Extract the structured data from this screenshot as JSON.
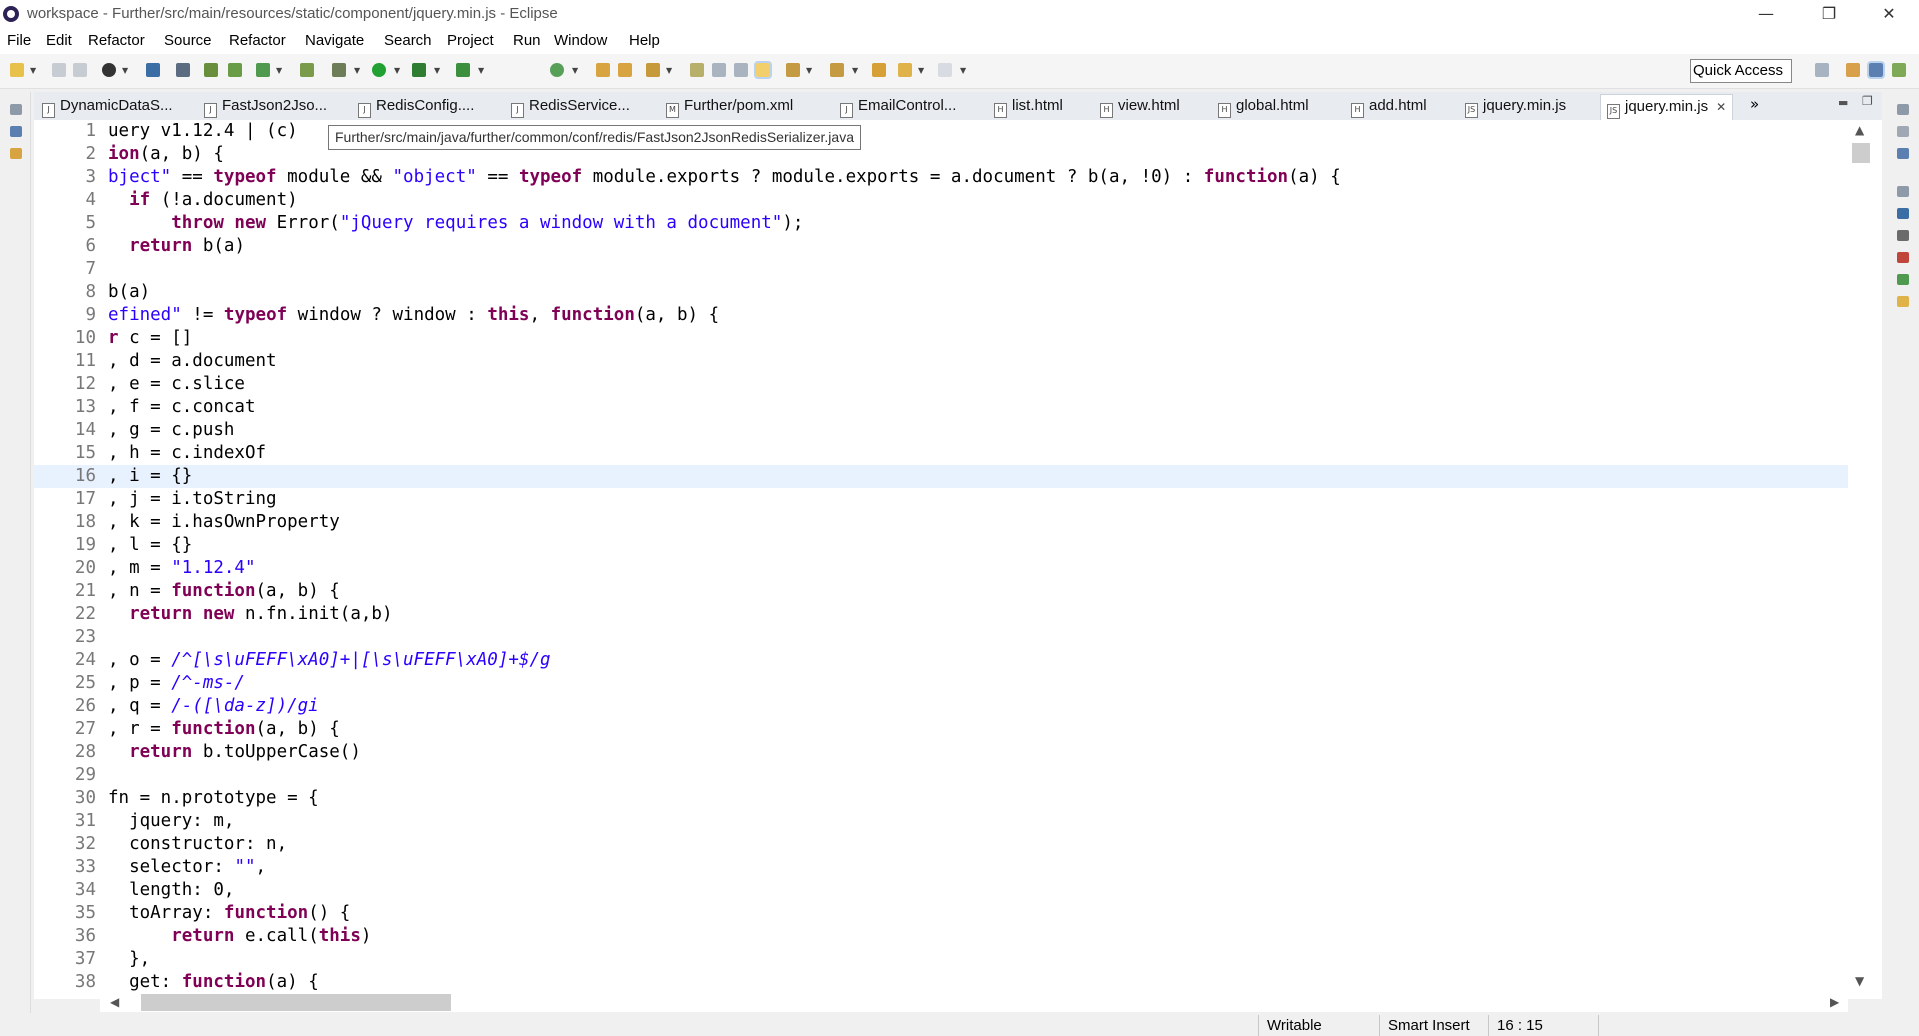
{
  "window": {
    "title": "workspace - Further/src/main/resources/static/component/jquery.min.js - Eclipse",
    "minimize_glyph": "—",
    "restore_glyph": "❐",
    "close_glyph": "✕"
  },
  "menu": [
    "File",
    "Edit",
    "Refactor",
    "Source",
    "Refactor",
    "Navigate",
    "Search",
    "Project",
    "Run",
    "Window",
    "Help"
  ],
  "toolbar": {
    "quick_access": "Quick Access"
  },
  "tabs": [
    {
      "label": "DynamicDataS...",
      "icon": "J"
    },
    {
      "label": "FastJson2Jso...",
      "icon": "J"
    },
    {
      "label": "RedisConfig....",
      "icon": "J"
    },
    {
      "label": "RedisService...",
      "icon": "J"
    },
    {
      "label": "Further/pom.xml",
      "icon": "M"
    },
    {
      "label": "EmailControl...",
      "icon": "J"
    },
    {
      "label": "list.html",
      "icon": "H"
    },
    {
      "label": "view.html",
      "icon": "H"
    },
    {
      "label": "global.html",
      "icon": "H"
    },
    {
      "label": "add.html",
      "icon": "H"
    },
    {
      "label": "jquery.min.js",
      "icon": "JS"
    },
    {
      "label": "jquery.min.js",
      "icon": "JS",
      "active": true
    }
  ],
  "tab_overflow": "»",
  "tooltip": "Further/src/main/java/further/common/conf/redis/FastJson2JsonRedisSerializer.java",
  "code": [
    [
      [
        "n",
        "1"
      ],
      [
        "p",
        "uery v1.12.4 | (c)"
      ]
    ],
    [
      [
        "n",
        "2"
      ],
      [
        "k",
        "ion"
      ],
      [
        "p",
        "(a, b) {"
      ]
    ],
    [
      [
        "n",
        "3"
      ],
      [
        "s",
        "bject\""
      ],
      [
        "p",
        " == "
      ],
      [
        "k",
        "typeof"
      ],
      [
        "p",
        " module && "
      ],
      [
        "s",
        "\"object\""
      ],
      [
        "p",
        " == "
      ],
      [
        "k",
        "typeof"
      ],
      [
        "p",
        " module.exports ? module.exports = a.document ? b(a, !0) : "
      ],
      [
        "k",
        "function"
      ],
      [
        "p",
        "(a) {"
      ]
    ],
    [
      [
        "n",
        "4"
      ],
      [
        "p",
        "  "
      ],
      [
        "k",
        "if"
      ],
      [
        "p",
        " (!a.document)"
      ]
    ],
    [
      [
        "n",
        "5"
      ],
      [
        "p",
        "      "
      ],
      [
        "k",
        "throw new"
      ],
      [
        "p",
        " Error("
      ],
      [
        "s",
        "\"jQuery requires a window with a document\""
      ],
      [
        "p",
        ");"
      ]
    ],
    [
      [
        "n",
        "6"
      ],
      [
        "p",
        "  "
      ],
      [
        "k",
        "return"
      ],
      [
        "p",
        " b(a)"
      ]
    ],
    [
      [
        "n",
        "7"
      ],
      [
        "p",
        ""
      ]
    ],
    [
      [
        "n",
        "8"
      ],
      [
        "p",
        "b(a)"
      ]
    ],
    [
      [
        "n",
        "9"
      ],
      [
        "s",
        "efined\""
      ],
      [
        "p",
        " != "
      ],
      [
        "k",
        "typeof"
      ],
      [
        "p",
        " window ? window : "
      ],
      [
        "k",
        "this"
      ],
      [
        "p",
        ", "
      ],
      [
        "k",
        "function"
      ],
      [
        "p",
        "(a, b) {"
      ]
    ],
    [
      [
        "n",
        "10"
      ],
      [
        "k",
        "r"
      ],
      [
        "p",
        " c = []"
      ]
    ],
    [
      [
        "n",
        "11"
      ],
      [
        "p",
        ", d = a.document"
      ]
    ],
    [
      [
        "n",
        "12"
      ],
      [
        "p",
        ", e = c.slice"
      ]
    ],
    [
      [
        "n",
        "13"
      ],
      [
        "p",
        ", f = c.concat"
      ]
    ],
    [
      [
        "n",
        "14"
      ],
      [
        "p",
        ", g = c.push"
      ]
    ],
    [
      [
        "n",
        "15"
      ],
      [
        "p",
        ", h = c.indexOf"
      ]
    ],
    [
      [
        "n",
        "16"
      ],
      [
        "p",
        ", i = {}"
      ]
    ],
    [
      [
        "n",
        "17"
      ],
      [
        "p",
        ", j = i.toString"
      ]
    ],
    [
      [
        "n",
        "18"
      ],
      [
        "p",
        ", k = i.hasOwnProperty"
      ]
    ],
    [
      [
        "n",
        "19"
      ],
      [
        "p",
        ", l = {}"
      ]
    ],
    [
      [
        "n",
        "20"
      ],
      [
        "p",
        ", m = "
      ],
      [
        "s",
        "\"1.12.4\""
      ]
    ],
    [
      [
        "n",
        "21"
      ],
      [
        "p",
        ", n = "
      ],
      [
        "k",
        "function"
      ],
      [
        "p",
        "(a, b) {"
      ]
    ],
    [
      [
        "n",
        "22"
      ],
      [
        "p",
        "  "
      ],
      [
        "k",
        "return new"
      ],
      [
        "p",
        " n.fn.init(a,b)"
      ]
    ],
    [
      [
        "n",
        "23"
      ],
      [
        "p",
        ""
      ]
    ],
    [
      [
        "n",
        "24"
      ],
      [
        "p",
        ", o = "
      ],
      [
        "r",
        "/^[\\s\\uFEFF\\xA0]+|[\\s\\uFEFF\\xA0]+$/g"
      ]
    ],
    [
      [
        "n",
        "25"
      ],
      [
        "p",
        ", p = "
      ],
      [
        "r",
        "/^-ms-/"
      ]
    ],
    [
      [
        "n",
        "26"
      ],
      [
        "p",
        ", q = "
      ],
      [
        "r",
        "/-([\\da-z])/gi"
      ]
    ],
    [
      [
        "n",
        "27"
      ],
      [
        "p",
        ", r = "
      ],
      [
        "k",
        "function"
      ],
      [
        "p",
        "(a, b) {"
      ]
    ],
    [
      [
        "n",
        "28"
      ],
      [
        "p",
        "  "
      ],
      [
        "k",
        "return"
      ],
      [
        "p",
        " b.toUpperCase()"
      ]
    ],
    [
      [
        "n",
        "29"
      ],
      [
        "p",
        ""
      ]
    ],
    [
      [
        "n",
        "30"
      ],
      [
        "p",
        "fn = n.prototype = {"
      ]
    ],
    [
      [
        "n",
        "31"
      ],
      [
        "p",
        "  jquery: m,"
      ]
    ],
    [
      [
        "n",
        "32"
      ],
      [
        "p",
        "  constructor: n,"
      ]
    ],
    [
      [
        "n",
        "33"
      ],
      [
        "p",
        "  selector: "
      ],
      [
        "s",
        "\"\""
      ],
      [
        "p",
        ","
      ]
    ],
    [
      [
        "n",
        "34"
      ],
      [
        "p",
        "  length: 0,"
      ]
    ],
    [
      [
        "n",
        "35"
      ],
      [
        "p",
        "  toArray: "
      ],
      [
        "k",
        "function"
      ],
      [
        "p",
        "() {"
      ]
    ],
    [
      [
        "n",
        "36"
      ],
      [
        "p",
        "      "
      ],
      [
        "k",
        "return"
      ],
      [
        "p",
        " e.call("
      ],
      [
        "k",
        "this"
      ],
      [
        "p",
        ")"
      ]
    ],
    [
      [
        "n",
        "37"
      ],
      [
        "p",
        "  },"
      ]
    ],
    [
      [
        "n",
        "38"
      ],
      [
        "p",
        "  get: "
      ],
      [
        "k",
        "function"
      ],
      [
        "p",
        "(a) {"
      ]
    ]
  ],
  "current_line": 16,
  "status": {
    "writable": "Writable",
    "insert_mode": "Smart Insert",
    "position": "16 : 15"
  },
  "colors": {
    "keyword": "#7f0055",
    "string": "#2a00ff",
    "line_number": "#787878",
    "current_line": "#e8f2fe"
  }
}
